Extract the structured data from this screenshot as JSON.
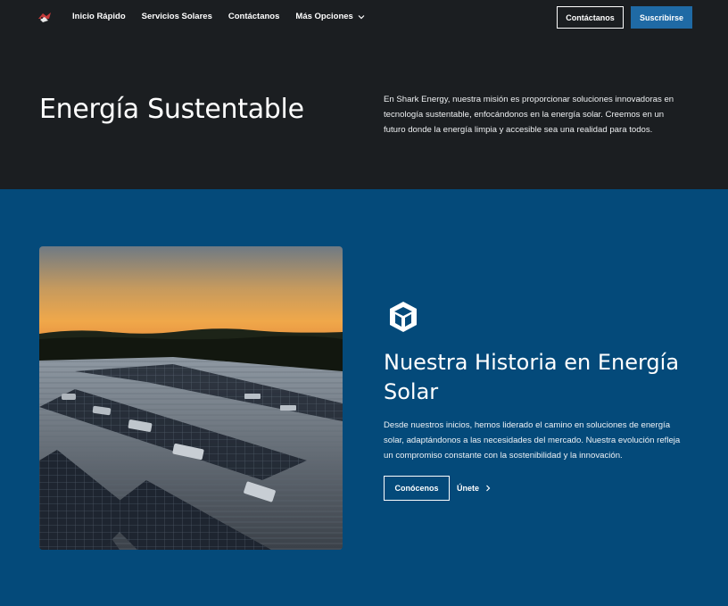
{
  "nav": {
    "links": [
      "Inicio Rápido",
      "Servicios Solares",
      "Contáctanos",
      "Más Opciones"
    ],
    "contact_button": "Contáctanos",
    "subscribe_button": "Suscribirse"
  },
  "hero": {
    "title": "Energía Sustentable",
    "description": "En Shark Energy, nuestra misión es proporcionar soluciones innovadoras en tecnología sustentable, enfocándonos en la energía solar. Creemos en un futuro donde la energía limpia y accesible sea una realidad para todos."
  },
  "feature": {
    "icon": "cube-icon",
    "title": "Nuestra Historia en Energía Solar",
    "description": "Desde nuestros inicios, hemos liderado el camino en soluciones de energía solar, adaptándonos a las necesidades del mercado. Nuestra evolución refleja un compromiso constante con la sostenibilidad y la innovación.",
    "primary_button": "Conócenos",
    "secondary_link": "Únete"
  },
  "colors": {
    "dark_bg": "#1b1e21",
    "brand_blue": "#044a7a",
    "button_blue": "#1f6aa5"
  }
}
